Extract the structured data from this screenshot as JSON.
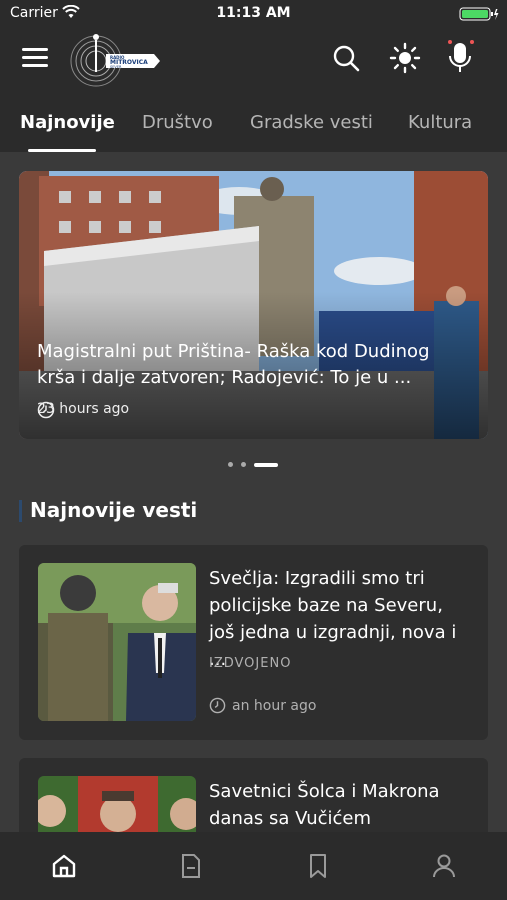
{
  "status_bar": {
    "carrier": "Carrier",
    "time": "11:13 AM"
  },
  "header": {
    "logo_text": "RADIO MITROVICA SEVER"
  },
  "tabs": [
    {
      "label": "Najnovije",
      "active": true
    },
    {
      "label": "Društvo",
      "active": false
    },
    {
      "label": "Gradske vesti",
      "active": false
    },
    {
      "label": "Kultura",
      "active": false
    }
  ],
  "hero": {
    "title": "Magistralni put Priština- Raška kod Dudinog krša i dalje zatvoren; Radojević: To je u ...",
    "time": "23 hours ago",
    "slide_count": 3,
    "active_slide": 3
  },
  "section": {
    "title": "Najnovije vesti"
  },
  "articles": [
    {
      "title": "Svečlja: Izgradili smo tri policijske baze na Severu, još jedna u izgradnji, nova i ...",
      "category": "IZDVOJENO",
      "time": "an hour ago"
    },
    {
      "title": "Savetnici Šolca i Makrona danas sa Vučićem",
      "category": "",
      "time": ""
    }
  ],
  "bottom_nav": [
    {
      "icon": "home-icon",
      "active": true
    },
    {
      "icon": "document-icon",
      "active": false
    },
    {
      "icon": "bookmark-icon",
      "active": false
    },
    {
      "icon": "profile-icon",
      "active": false
    }
  ],
  "colors": {
    "background": "#2b2b2b",
    "content": "#3a3a3a",
    "card": "#2e2e2e",
    "section_accent": "#2c4a6e",
    "battery": "#4cd964"
  }
}
